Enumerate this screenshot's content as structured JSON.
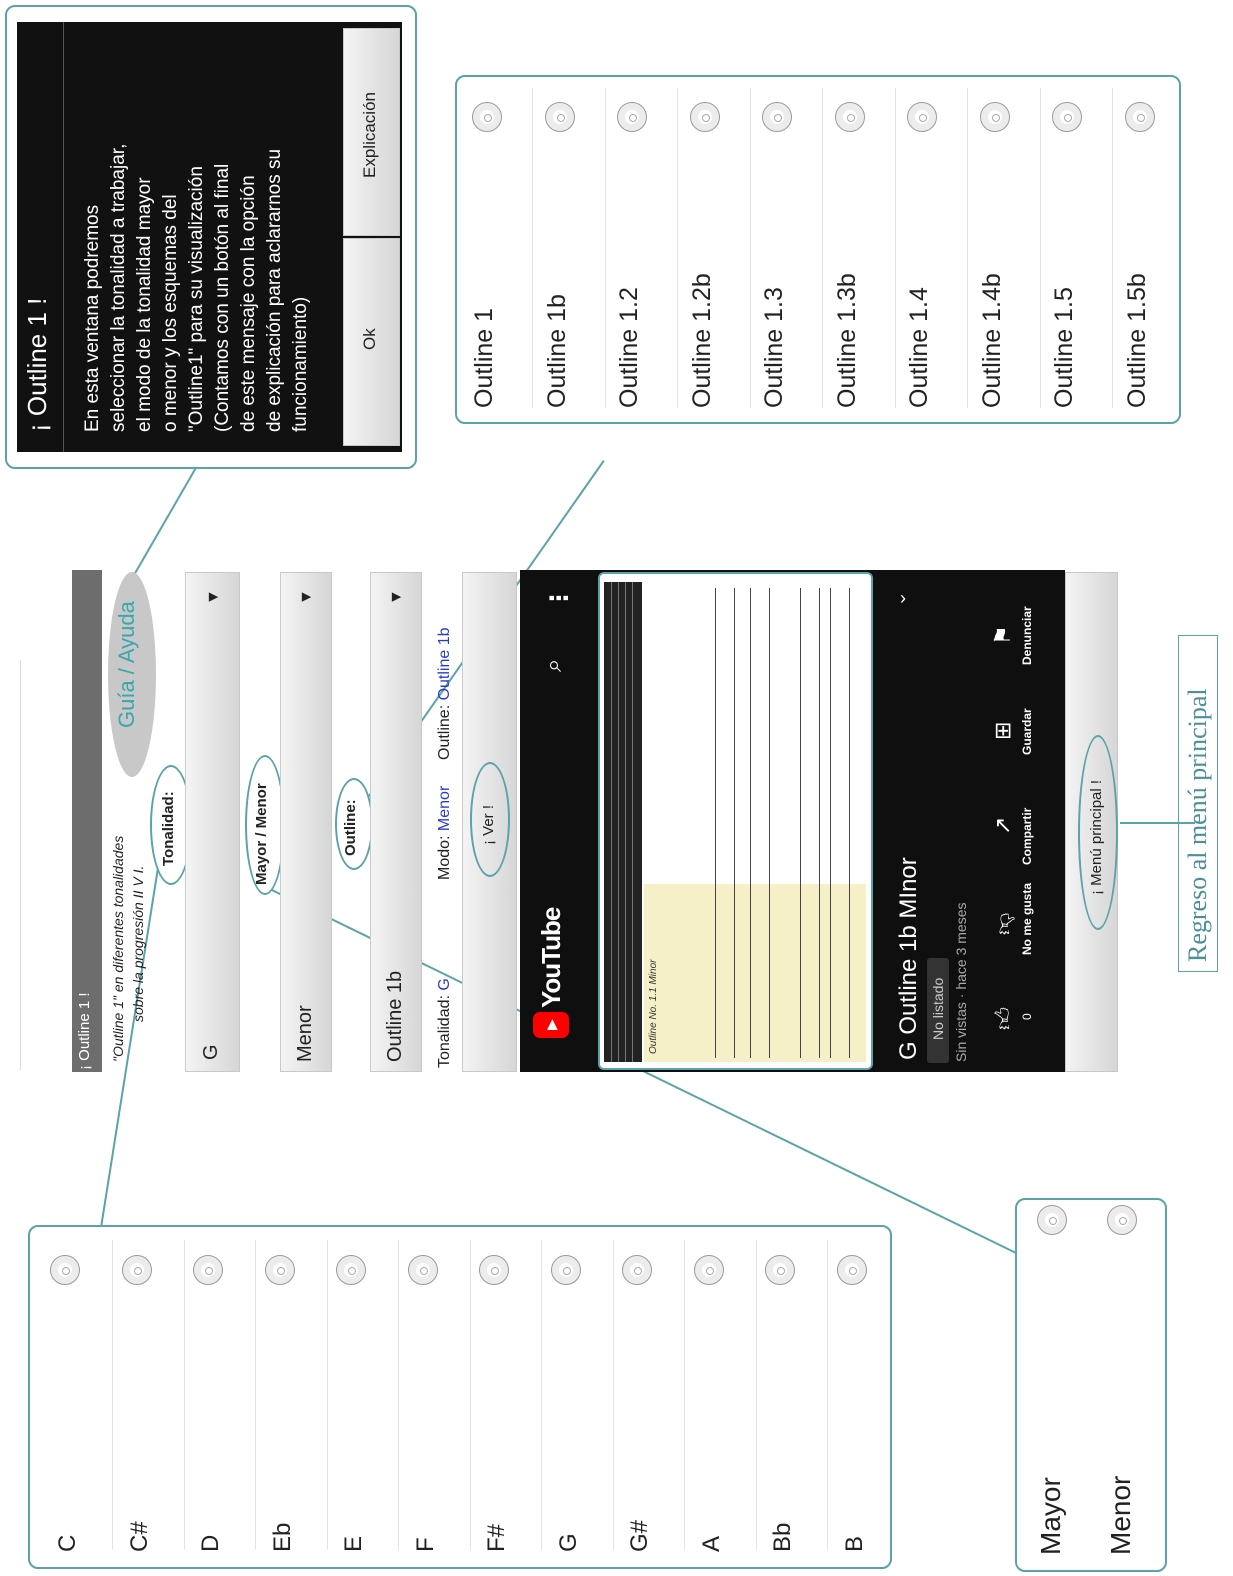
{
  "app_screen": {
    "title_bar": "¡ Outline 1 !",
    "subtitle_line1": "\"Outline 1\" en diferentes tonalidades",
    "subtitle_line2": "sobre la progresión II V I.",
    "guide_button": "Guía / Ayuda",
    "key_select_value": "G",
    "mode_select_value": "Menor",
    "outline_select_value": "Outline 1b",
    "status_tonalidad_label": "Tonalidad:",
    "status_tonalidad_value": "G",
    "status_modo_label": "Modo:",
    "status_modo_value": "Menor",
    "status_outline_label": "Outline:",
    "status_outline_value": "Outline 1b",
    "ver_button": "¡ Ver !",
    "main_menu_button": "¡ Menú principal !"
  },
  "callouts": {
    "tonalidad": "Tonalidad:",
    "mayor_menor": "Mayor / Menor",
    "outline": "Outline:"
  },
  "youtube": {
    "brand": "YouTube",
    "sheet_caption": "Outline No. 1.1 Minor",
    "video_title": "G Outline 1b MInor",
    "badge": "No listado",
    "meta": "Sin vistas · hace 3 meses",
    "actions": [
      {
        "icon": "thumb-up-icon",
        "label": "0"
      },
      {
        "icon": "thumb-down-icon",
        "label": "No me gusta"
      },
      {
        "icon": "share-icon",
        "label": "Compartir"
      },
      {
        "icon": "save-icon",
        "label": "Guardar"
      },
      {
        "icon": "flag-icon",
        "label": "Denunciar"
      }
    ]
  },
  "tone_list": [
    "C",
    "C#",
    "D",
    "Eb",
    "E",
    "F",
    "F#",
    "G",
    "G#",
    "A",
    "Bb",
    "B"
  ],
  "mode_list": [
    "Mayor",
    "Menor"
  ],
  "outline_list": [
    "Outline 1",
    "Outline 1b",
    "Outline 1.2",
    "Outline 1.2b",
    "Outline 1.3",
    "Outline 1.3b",
    "Outline 1.4",
    "Outline 1.4b",
    "Outline 1.5",
    "Outline 1.5b"
  ],
  "dialog": {
    "title": "¡ Outline 1 !",
    "lines": [
      "En esta ventana podremos",
      "seleccionar la tonalidad a trabajar,",
      "el modo de la tonalidad mayor",
      "o menor y los esquemas del",
      "\"Outline1\" para su visualización",
      "(Contamos con un botón al final",
      "de este mensaje con la opción",
      "de explicación para aclararnos su",
      "funcionamiento)"
    ],
    "ok_button": "Ok",
    "explain_button": "Explicación"
  },
  "footer_caption": "Regreso al menú principal",
  "colors": {
    "accent": "#5aa3a8",
    "link_blue": "#2a3cc4",
    "youtube_red": "#ff0000"
  }
}
